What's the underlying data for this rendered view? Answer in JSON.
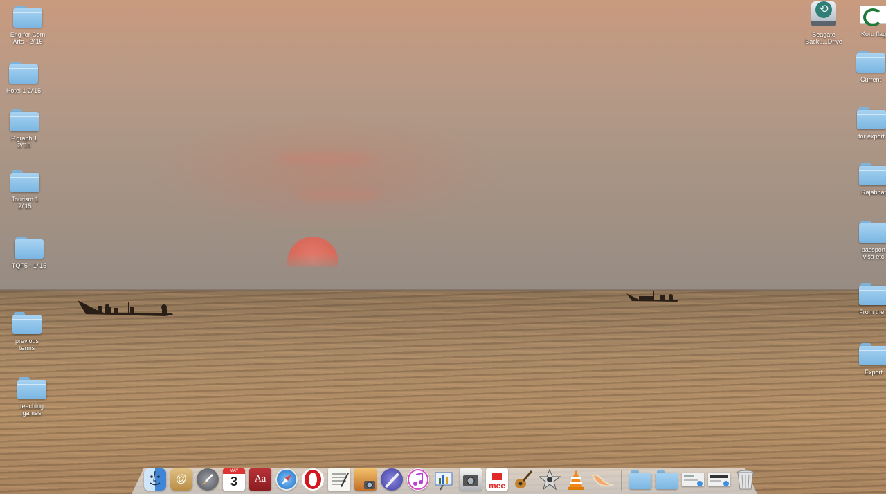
{
  "desktop": {
    "left_icons": [
      {
        "label": "Eng for Com\nArts - 2/'15",
        "name": "folder-eng-for-com-arts"
      },
      {
        "label": "Hotel 1  2/'15",
        "name": "folder-hotel-1"
      },
      {
        "label": "P.graph 1\n2/'15",
        "name": "folder-pgraph-1"
      },
      {
        "label": "Tourism 1\n2/'15",
        "name": "folder-tourism-1"
      },
      {
        "label": "TQF5 - 1/'15",
        "name": "folder-tqf5"
      },
      {
        "label": "previous\nterms",
        "name": "folder-previous-terms"
      },
      {
        "label": "teaching\ngames",
        "name": "folder-teaching-games"
      }
    ],
    "right_icons": [
      {
        "label": "Seagate\nBacku...Drive",
        "name": "drive-seagate",
        "icon": "time-machine-drive-icon"
      },
      {
        "label": "Koru flag",
        "name": "file-koru-flag",
        "icon": "koru-image-icon"
      },
      {
        "label": "Current",
        "name": "folder-current"
      },
      {
        "label": "for export",
        "name": "folder-for-export"
      },
      {
        "label": "Rajabhat",
        "name": "folder-rajabhat"
      },
      {
        "label": "passport\nvisa etc",
        "name": "folder-passport-visa"
      },
      {
        "label": "From the r",
        "name": "folder-from-the"
      },
      {
        "label": "Export",
        "name": "folder-export"
      }
    ]
  },
  "dock": {
    "calendar_month": "MAY",
    "calendar_day": "3",
    "dictionary_glyph": "Aa",
    "mee_label": "mee",
    "apps": [
      {
        "name": "finder-icon",
        "color": "#4a8fd8"
      },
      {
        "name": "contacts-icon",
        "color": "#c9a25a"
      },
      {
        "name": "launchpad-icon",
        "color": "#6d6f73"
      },
      {
        "name": "calendar-icon",
        "color": "#ffffff"
      },
      {
        "name": "dictionary-icon",
        "color": "#a3272b"
      },
      {
        "name": "safari-icon",
        "color": "#3d8ee0"
      },
      {
        "name": "opera-icon",
        "color": "#d3161e"
      },
      {
        "name": "textedit-icon",
        "color": "#f2f2f2"
      },
      {
        "name": "iphoto-icon",
        "color": "#b8722e"
      },
      {
        "name": "brush-app-icon",
        "color": "#5b58c0"
      },
      {
        "name": "itunes-icon",
        "color": "#d64ac8"
      },
      {
        "name": "keynote-icon",
        "color": "#4478c6"
      },
      {
        "name": "image-capture-icon",
        "color": "#8a8d90"
      },
      {
        "name": "mee-app-icon",
        "color": "#e02a2a"
      },
      {
        "name": "garageband-icon",
        "color": "#c08a3a"
      },
      {
        "name": "imovie-icon",
        "color": "#8c8c8c"
      },
      {
        "name": "vlc-icon",
        "color": "#f08a14"
      },
      {
        "name": "melon-app-icon",
        "color": "#f2a86a"
      }
    ],
    "right_items": [
      {
        "name": "dock-folder-1-icon"
      },
      {
        "name": "dock-folder-2-icon"
      },
      {
        "name": "dock-stack-1-icon"
      },
      {
        "name": "dock-stack-2-icon"
      },
      {
        "name": "trash-icon"
      }
    ]
  }
}
